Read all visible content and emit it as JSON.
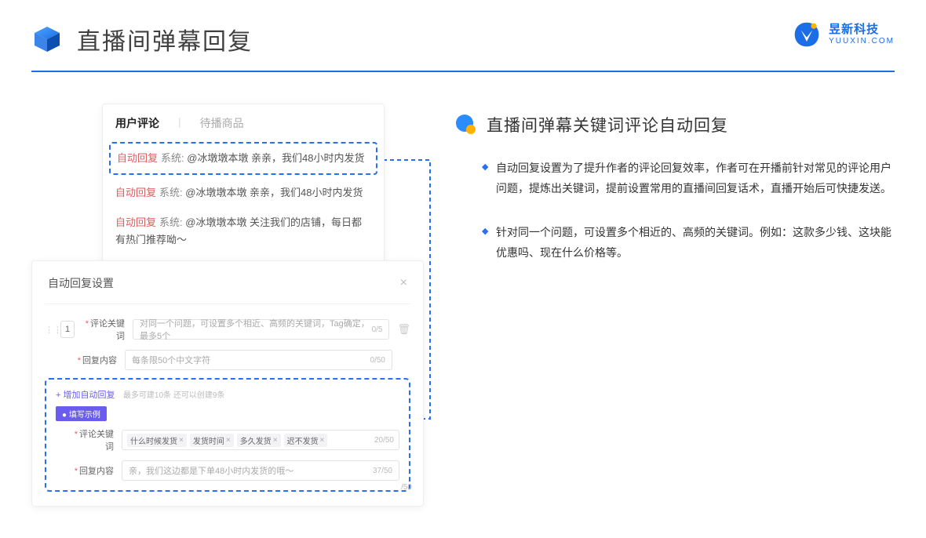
{
  "header": {
    "title": "直播间弹幕回复",
    "brand_name": "昱新科技",
    "brand_url": "YUUXIN.COM"
  },
  "comments": {
    "tab_active": "用户评论",
    "tab_inactive": "待播商品",
    "items": [
      {
        "auto": "自动回复",
        "sys": "系统:",
        "text": "@冰墩墩本墩 亲亲，我们48小时内发货",
        "hl": true
      },
      {
        "auto": "自动回复",
        "sys": "系统:",
        "text": "@冰墩墩本墩 亲亲，我们48小时内发货",
        "hl": false
      },
      {
        "auto": "自动回复",
        "sys": "系统:",
        "text": "@冰墩墩本墩 关注我们的店铺，每日都有热门推荐呦～",
        "hl": false
      }
    ]
  },
  "settings": {
    "title": "自动回复设置",
    "close": "×",
    "order": "1",
    "label_keyword": "评论关键词",
    "placeholder_keyword": "对同一个问题，可设置多个相近、高频的关键词，Tag确定，最多5个",
    "counter_keyword": "0/5",
    "label_content": "回复内容",
    "placeholder_content": "每条限50个中文字符",
    "counter_content": "0/50",
    "add_link": "+ 增加自动回复",
    "add_hint": "最多可建10条 还可以创建9条",
    "example_badge": "● 填写示例",
    "ex_label_keyword": "评论关键词",
    "ex_tags": [
      "什么时候发货",
      "发货时间",
      "多久发货",
      "迟不发货"
    ],
    "ex_counter_keyword": "20/50",
    "ex_label_content": "回复内容",
    "ex_content": "亲，我们这边都是下单48小时内发货的哦～",
    "ex_counter_content": "37/50",
    "overflow_counter": "/50"
  },
  "feature": {
    "title": "直播间弹幕关键词评论自动回复",
    "bullets": [
      "自动回复设置为了提升作者的评论回复效率，作者可在开播前针对常见的评论用户问题，提炼出关键词，提前设置常用的直播间回复话术，直播开始后可快捷发送。",
      "针对同一个问题，可设置多个相近的、高频的关键词。例如：这款多少钱、这块能优惠吗、现在什么价格等。"
    ]
  }
}
